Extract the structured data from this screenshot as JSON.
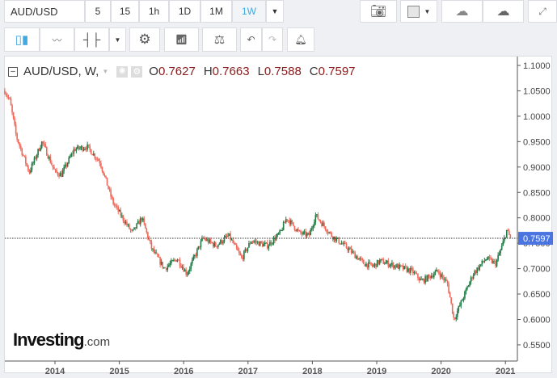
{
  "toolbar": {
    "symbol": "AUD/USD",
    "intervals": [
      "5",
      "15",
      "1h",
      "1D",
      "1M",
      "1W"
    ],
    "active_interval": "1W"
  },
  "legend": {
    "title": "AUD/USD, W,",
    "o_label": "O",
    "o": "0.7627",
    "h_label": "H",
    "h": "0.7663",
    "l_label": "L",
    "l": "0.7588",
    "c_label": "C",
    "c": "0.7597"
  },
  "logo": {
    "text": "Investing",
    "suffix": ".com"
  },
  "colors": {
    "up": "#1f7a45",
    "down": "#f0685a",
    "accent": "#3fa9e0",
    "price_label": "#4a74e0"
  },
  "chart_data": {
    "type": "candlestick",
    "title": "AUD/USD, W",
    "ylim": [
      0.52,
      1.11
    ],
    "xlim": [
      2013.22,
      2021.15
    ],
    "y_ticks": [
      "1.1000",
      "1.0500",
      "1.0000",
      "0.9500",
      "0.9000",
      "0.8500",
      "0.8000",
      "0.7500",
      "0.7000",
      "0.6500",
      "0.6000",
      "0.5500"
    ],
    "x_ticks": [
      "2014",
      "2015",
      "2016",
      "2017",
      "2018",
      "2019",
      "2020",
      "2021"
    ],
    "last_price": "0.7597",
    "path": [
      [
        2013.22,
        1.05
      ],
      [
        2013.3,
        1.03
      ],
      [
        2013.4,
        0.96
      ],
      [
        2013.6,
        0.89
      ],
      [
        2013.8,
        0.95
      ],
      [
        2014.0,
        0.89
      ],
      [
        2014.1,
        0.885
      ],
      [
        2014.3,
        0.935
      ],
      [
        2014.5,
        0.94
      ],
      [
        2014.7,
        0.91
      ],
      [
        2014.9,
        0.83
      ],
      [
        2015.0,
        0.81
      ],
      [
        2015.2,
        0.77
      ],
      [
        2015.35,
        0.8
      ],
      [
        2015.5,
        0.74
      ],
      [
        2015.7,
        0.7
      ],
      [
        2015.9,
        0.72
      ],
      [
        2016.05,
        0.69
      ],
      [
        2016.3,
        0.76
      ],
      [
        2016.5,
        0.745
      ],
      [
        2016.7,
        0.765
      ],
      [
        2016.9,
        0.72
      ],
      [
        2017.05,
        0.755
      ],
      [
        2017.3,
        0.745
      ],
      [
        2017.5,
        0.77
      ],
      [
        2017.6,
        0.8
      ],
      [
        2017.8,
        0.77
      ],
      [
        2017.95,
        0.765
      ],
      [
        2018.05,
        0.805
      ],
      [
        2018.3,
        0.765
      ],
      [
        2018.55,
        0.74
      ],
      [
        2018.8,
        0.71
      ],
      [
        2018.95,
        0.705
      ],
      [
        2019.05,
        0.715
      ],
      [
        2019.3,
        0.705
      ],
      [
        2019.55,
        0.695
      ],
      [
        2019.7,
        0.675
      ],
      [
        2019.95,
        0.695
      ],
      [
        2020.1,
        0.67
      ],
      [
        2020.2,
        0.6
      ],
      [
        2020.3,
        0.63
      ],
      [
        2020.5,
        0.69
      ],
      [
        2020.7,
        0.72
      ],
      [
        2020.85,
        0.71
      ],
      [
        2020.95,
        0.745
      ],
      [
        2021.02,
        0.775
      ],
      [
        2021.08,
        0.7597
      ]
    ]
  }
}
